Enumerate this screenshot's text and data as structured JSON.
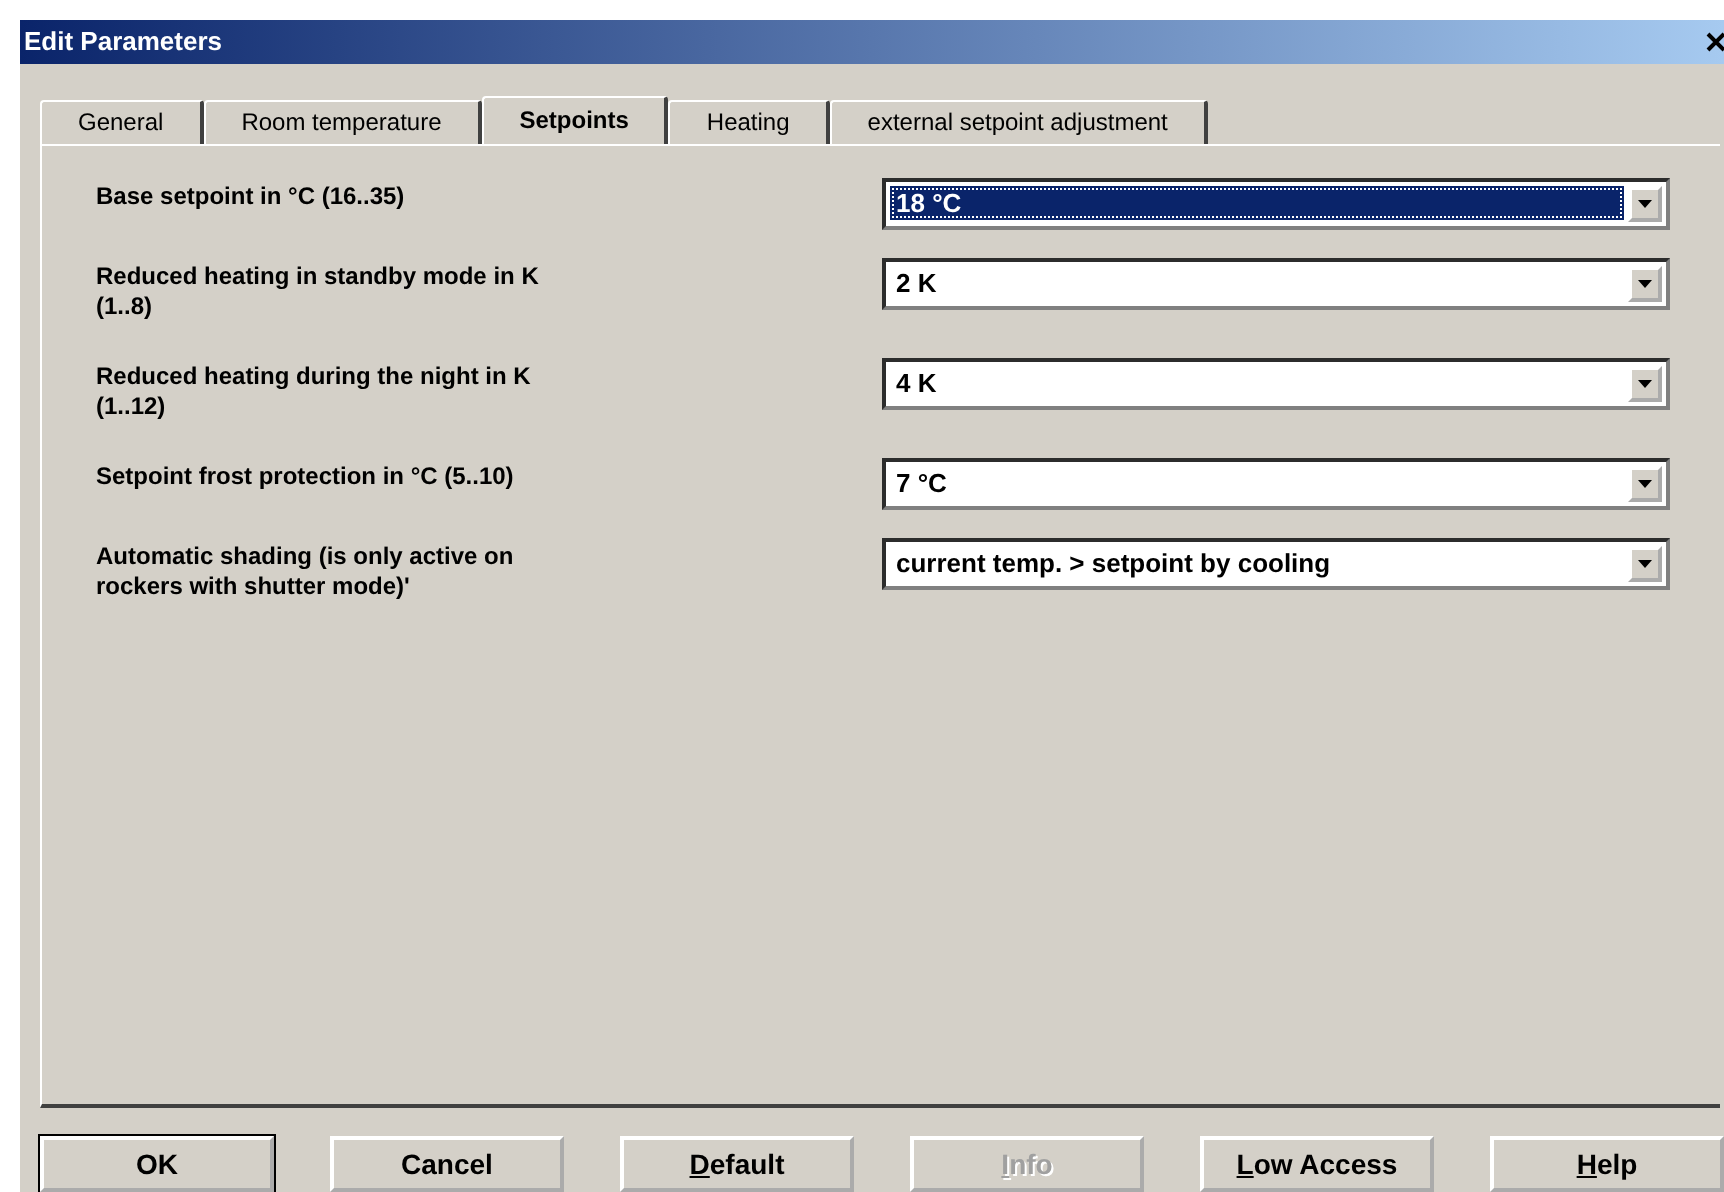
{
  "window": {
    "title": "Edit Parameters"
  },
  "tabs": [
    {
      "label": "General",
      "selected": false
    },
    {
      "label": "Room temperature",
      "selected": false
    },
    {
      "label": "Setpoints",
      "selected": true
    },
    {
      "label": "Heating",
      "selected": false
    },
    {
      "label": "external setpoint adjustment",
      "selected": false
    }
  ],
  "parameters": [
    {
      "label": "Base setpoint in °C  (16..35)",
      "value": "18 °C",
      "focused": true
    },
    {
      "label": "Reduced heating in standby mode in K\n(1..8)",
      "value": "2 K",
      "focused": false
    },
    {
      "label": "Reduced heating during the night in K\n(1..12)",
      "value": "4 K",
      "focused": false
    },
    {
      "label": "Setpoint frost protection in °C (5..10)",
      "value": "7 °C",
      "focused": false
    },
    {
      "label": "Automatic shading (is only active on\nrockers with shutter mode)'",
      "value": "current temp. > setpoint by cooling",
      "focused": false
    }
  ],
  "buttons": [
    {
      "label": "OK",
      "disabled": false,
      "default": true,
      "mnemonic": false
    },
    {
      "label": "Cancel",
      "disabled": false,
      "default": false,
      "mnemonic": false
    },
    {
      "label": "Default",
      "disabled": false,
      "default": false,
      "mnemonic": true
    },
    {
      "label": "Info",
      "disabled": true,
      "default": false,
      "mnemonic": true
    },
    {
      "label": "Low Access",
      "disabled": false,
      "default": false,
      "mnemonic": true
    },
    {
      "label": "Help",
      "disabled": false,
      "default": false,
      "mnemonic": true
    }
  ]
}
